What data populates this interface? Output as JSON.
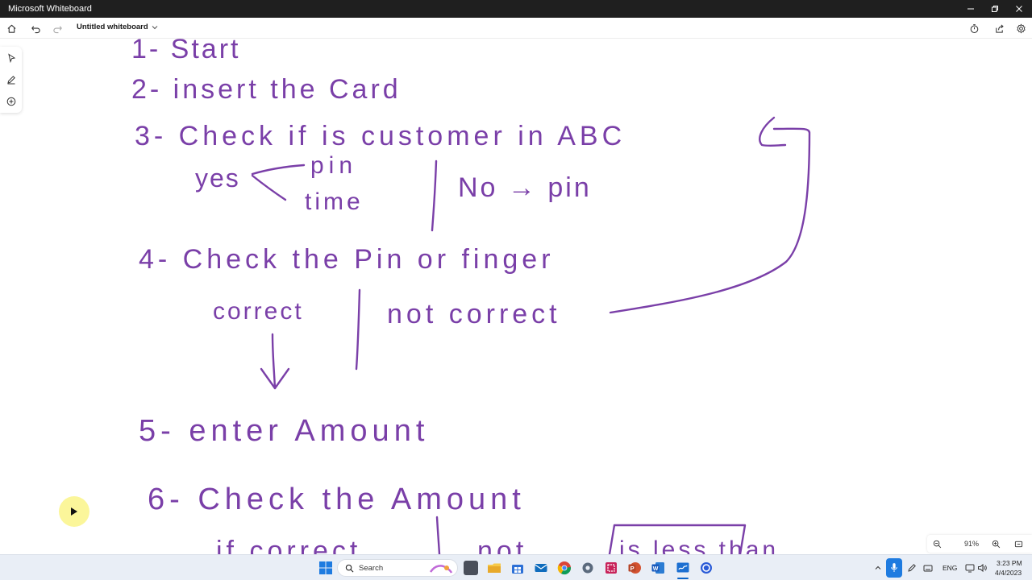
{
  "window": {
    "title": "Microsoft Whiteboard"
  },
  "toolbar": {
    "doc_title": "Untitled whiteboard"
  },
  "canvas": {
    "ink_color": "#7a3fa8",
    "lines": {
      "l1": "1- Start",
      "l2": "2- insert the Card",
      "l3": "3- Check if is customer in ABC",
      "yes": "yes",
      "pin": "pin",
      "time": "time",
      "no_pin": "No → pin",
      "l4": "4- Check the Pin or finger",
      "correct": "correct",
      "not_correct": "not correct",
      "l5": "5- enter Amount",
      "l6": "6- Check the Amount",
      "if_correct": "if correct",
      "not": "not",
      "is_less_than": "is less than"
    }
  },
  "zoom": {
    "level": "91%"
  },
  "taskbar": {
    "search_label": "Search",
    "language": "ENG",
    "time": "3:23 PM",
    "date": "4/4/2023"
  }
}
